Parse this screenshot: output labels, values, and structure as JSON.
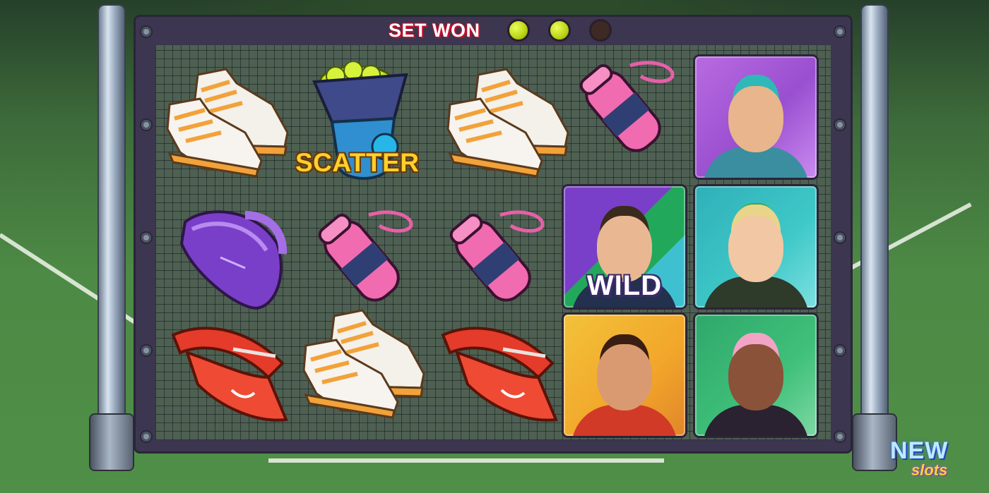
{
  "header": {
    "set_won_label": "SET WON",
    "set_balls": [
      {
        "state": "won",
        "color": "#c6df1e"
      },
      {
        "state": "won",
        "color": "#c6df1e"
      },
      {
        "state": "pending",
        "color": "#3d2a24"
      }
    ]
  },
  "reels": [
    [
      "sneakers",
      "tennis-bag",
      "visor-cap"
    ],
    [
      "ball-machine-scatter",
      "water-bottle",
      "sneakers"
    ],
    [
      "sneakers",
      "water-bottle",
      "visor-cap"
    ],
    [
      "water-bottle",
      "commentator-wild",
      "player-red-headband"
    ],
    [
      "player-teal-cap",
      "player-blonde-visor",
      "player-pink-cap"
    ]
  ],
  "symbols": {
    "scatter_label": "SCATTER",
    "wild_label": "WILD"
  },
  "branding": {
    "logo_top": "NEW",
    "logo_bottom": "slots"
  },
  "colors": {
    "frame": "#3c3650",
    "net": "#4e6052",
    "accent_red": "#c8102e",
    "scatter_gold": "#ffd02a"
  }
}
